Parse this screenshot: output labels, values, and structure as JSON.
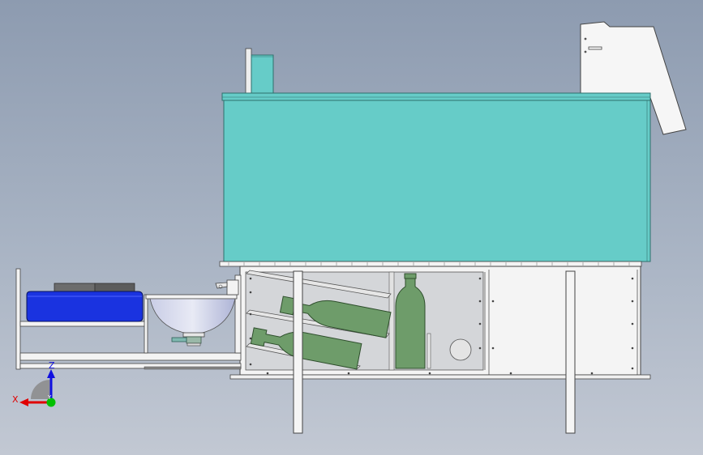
{
  "viewport": {
    "background_top": "#8d9bb0",
    "background_bottom": "#c2c8d3"
  },
  "colors": {
    "teal_body": "#66ccc8",
    "teal_edge": "#2f6f6c",
    "bottle_green": "#6e9c6a",
    "bottle_edge": "#2e4e2c",
    "blue_tray": "#1a33e0",
    "frame_white": "#f2f2f2",
    "outline": "#333333"
  },
  "triad": {
    "x_label": "X",
    "z_label": "Z",
    "y_label": "Y",
    "x_color": "#e00000",
    "z_color": "#1010e0",
    "y_color": "#00c000"
  }
}
